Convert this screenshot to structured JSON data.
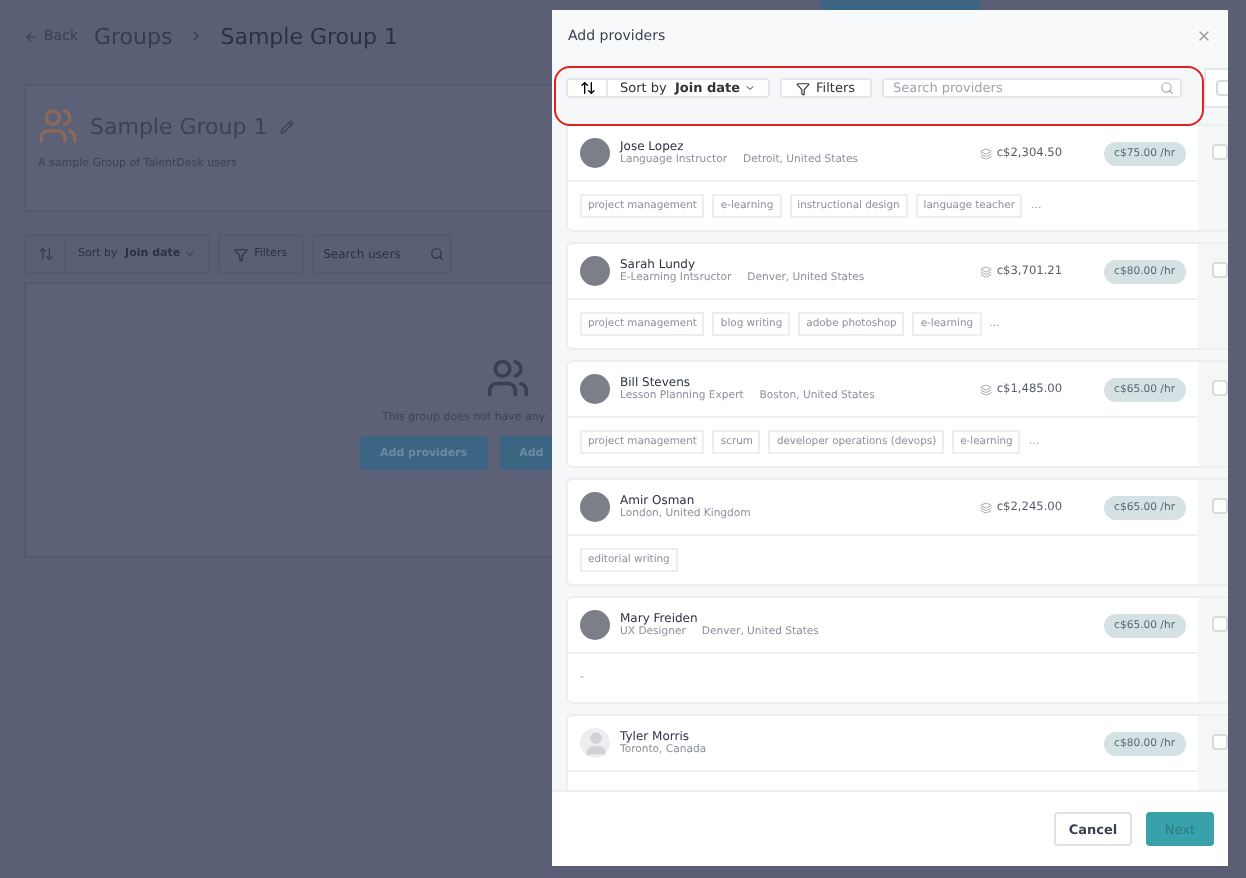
{
  "background_page": {
    "back": "Back",
    "breadcrumb": [
      "Groups",
      "Sample Group 1"
    ],
    "group": {
      "title": "Sample Group 1",
      "description": "A sample Group of TalentDesk users"
    },
    "toolbar": {
      "sort_prefix": "Sort by",
      "sort_value": "Join date",
      "filters": "Filters",
      "search_placeholder": "Search users"
    },
    "empty_message": "This group does not have any",
    "buttons": [
      "Add providers",
      "Add"
    ]
  },
  "modal": {
    "title": "Add providers",
    "toolbar": {
      "sort_prefix": "Sort by",
      "sort_value": "Join date",
      "filters": "Filters",
      "search_placeholder": "Search providers",
      "select_all_checked": false
    },
    "providers": [
      {
        "name": "Jose Lopez",
        "title": "Language Instructor",
        "location": "Detroit, United States",
        "earnings": "c$2,304.50",
        "rate": "c$75.00 /hr",
        "has_photo": true,
        "tags": [
          "project management",
          "e-learning",
          "instructional design",
          "language teacher"
        ],
        "more": "...",
        "checked": false
      },
      {
        "name": "Sarah Lundy",
        "title": "E-Learning Intsructor",
        "location": "Denver, United States",
        "earnings": "c$3,701.21",
        "rate": "c$80.00 /hr",
        "has_photo": true,
        "tags": [
          "project management",
          "blog writing",
          "adobe photoshop",
          "e-learning"
        ],
        "more": "...",
        "checked": false
      },
      {
        "name": "Bill Stevens",
        "title": "Lesson Planning Expert",
        "location": "Boston, United States",
        "earnings": "c$1,485.00",
        "rate": "c$65.00 /hr",
        "has_photo": true,
        "tags": [
          "project management",
          "scrum",
          "developer operations (devops)",
          "e-learning"
        ],
        "more": "...",
        "checked": false
      },
      {
        "name": "Amir Osman",
        "location": "London, United Kingdom",
        "earnings": "c$2,245.00",
        "rate": "c$65.00 /hr",
        "has_photo": true,
        "tags": [
          "editorial writing"
        ],
        "checked": false
      },
      {
        "name": "Mary Freiden",
        "title": "UX Designer",
        "location": "Denver, United States",
        "rate": "c$65.00 /hr",
        "has_photo": true,
        "empty_tags": "-",
        "checked": false
      },
      {
        "name": "Tyler Morris",
        "location": "Toronto, Canada",
        "rate": "c$80.00 /hr",
        "has_photo": false,
        "checked": false
      }
    ],
    "buttons": {
      "cancel": "Cancel",
      "next": "Next"
    }
  }
}
